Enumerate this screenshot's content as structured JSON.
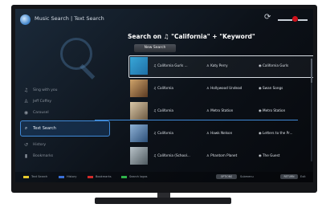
{
  "header": {
    "title": "Music Search | Text Search"
  },
  "sidebar": {
    "items": [
      {
        "label": "Sing with you",
        "icon": "music-note-icon"
      },
      {
        "label": "Jeff Coffey",
        "icon": "person-icon"
      },
      {
        "label": "Carousel",
        "icon": "disc-icon"
      },
      {
        "label": "Text Search",
        "icon": "search-icon",
        "selected": true
      },
      {
        "label": "History",
        "icon": "history-icon"
      },
      {
        "label": "Bookmarks",
        "icon": "bookmark-icon"
      }
    ]
  },
  "main": {
    "title": "Search on ♫ \"California\" + \"Keyword\"",
    "new_search_label": "New Search",
    "results": [
      {
        "track": "California Gurls ...",
        "artist": "Katy Perry",
        "album": "California Gurls",
        "selected": true,
        "thumb_colors": [
          "#38a7d8",
          "#1f6fa5"
        ]
      },
      {
        "track": "California",
        "artist": "Hollywood Undead",
        "album": "Swan Songs",
        "thumb_colors": [
          "#cfa36a",
          "#5a3a22"
        ]
      },
      {
        "track": "California",
        "artist": "Metro Station",
        "album": "Metro Station",
        "thumb_colors": [
          "#d9c7a8",
          "#6d5a42"
        ]
      },
      {
        "track": "California",
        "artist": "Hawk Nelson",
        "album": "Letters to the Pr...",
        "thumb_colors": [
          "#8fb2d6",
          "#2c4f78"
        ]
      },
      {
        "track": "California (School...",
        "artist": "Phantom Planet",
        "album": "The Guest",
        "thumb_colors": [
          "#b9c3c9",
          "#4f5a60"
        ]
      }
    ]
  },
  "footer": {
    "legend": [
      {
        "label": "Text Search",
        "color": "#e5c82e"
      },
      {
        "label": "History",
        "color": "#3a6fd6"
      },
      {
        "label": "Bookmarks",
        "color": "#d12a2a"
      },
      {
        "label": "Search logos",
        "color": "#2fb34a"
      }
    ],
    "options_key": "OPTIONS",
    "options_label": "Submenu",
    "return_key": "RETURN",
    "return_label": "Exit"
  },
  "colors": {
    "accent": "#3f89d6",
    "status_red": "#d0111b"
  }
}
